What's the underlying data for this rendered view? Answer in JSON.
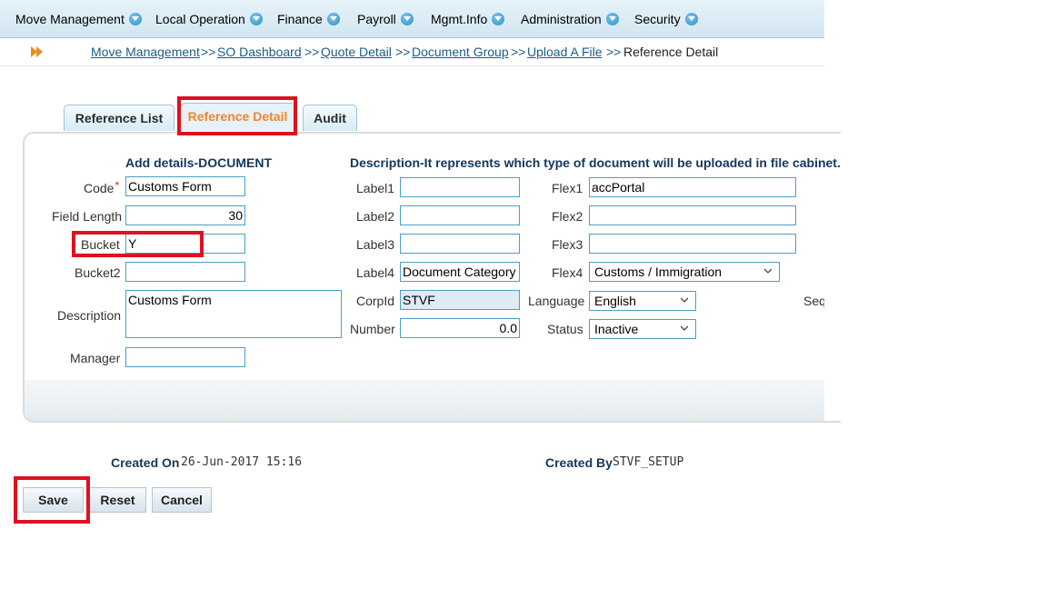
{
  "menu": [
    {
      "label": "Move Management"
    },
    {
      "label": "Local Operation"
    },
    {
      "label": "Finance"
    },
    {
      "label": "Payroll"
    },
    {
      "label": "Mgmt.Info"
    },
    {
      "label": "Administration"
    },
    {
      "label": "Security"
    }
  ],
  "breadcrumb": {
    "links": [
      "Move Management",
      "SO Dashboard",
      "Quote Detail",
      "Document Group",
      "Upload A File"
    ],
    "separator": ">>",
    "current": "Reference Detail"
  },
  "tabs": [
    {
      "label": "Reference List"
    },
    {
      "label": "Reference Detail",
      "active": true
    },
    {
      "label": "Audit"
    }
  ],
  "form": {
    "heading": "Add details-DOCUMENT",
    "description_heading": "Description-It represents which type of document will be uploaded in file cabinet.",
    "code": {
      "label": "Code",
      "required_mark": "*",
      "value": "Customs Form"
    },
    "field_length": {
      "label": "Field Length",
      "value": "30"
    },
    "bucket": {
      "label": "Bucket",
      "value": "Y"
    },
    "bucket2": {
      "label": "Bucket2",
      "value": ""
    },
    "description": {
      "label": "Description",
      "value": "Customs Form"
    },
    "manager": {
      "label": "Manager",
      "value": ""
    },
    "label1": {
      "label": "Label1",
      "value": ""
    },
    "label2": {
      "label": "Label2",
      "value": ""
    },
    "label3": {
      "label": "Label3",
      "value": ""
    },
    "label4": {
      "label": "Label4",
      "value": "Document Category"
    },
    "corpid": {
      "label": "CorpId",
      "value": "STVF"
    },
    "number": {
      "label": "Number",
      "value": "0.0"
    },
    "flex1": {
      "label": "Flex1",
      "value": "accPortal"
    },
    "flex2": {
      "label": "Flex2",
      "value": ""
    },
    "flex3": {
      "label": "Flex3",
      "value": ""
    },
    "flex4": {
      "label": "Flex4",
      "value": "Customs / Immigration"
    },
    "language": {
      "label": "Language",
      "value": "English"
    },
    "status": {
      "label": "Status",
      "value": "Inactive"
    },
    "seq": {
      "label": "Seq"
    }
  },
  "meta": {
    "created_on_label": "Created On",
    "created_on": "26-Jun-2017 15:16",
    "created_by_label": "Created By",
    "created_by": "STVF_SETUP"
  },
  "buttons": {
    "save": "Save",
    "reset": "Reset",
    "cancel": "Cancel"
  },
  "colors": {
    "highlight": "#e0101e",
    "active_tab": "#f0862a",
    "link": "#1a5c8c"
  }
}
